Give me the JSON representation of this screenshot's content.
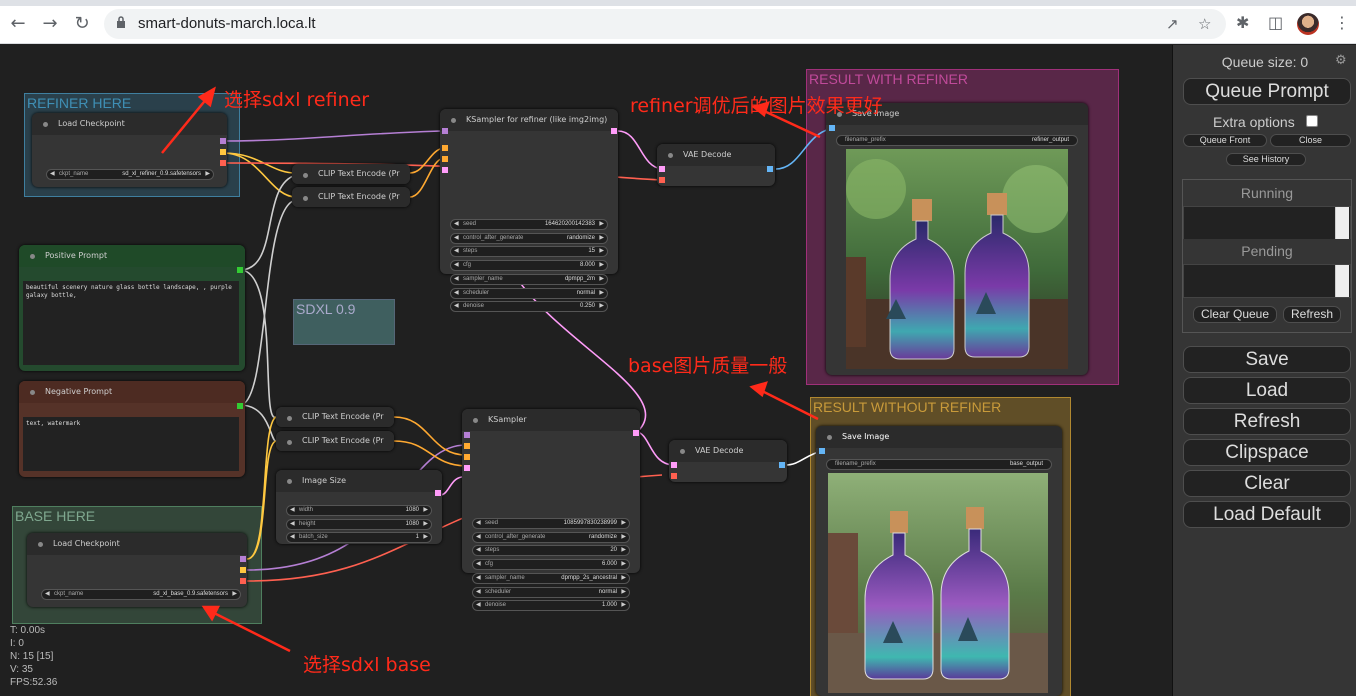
{
  "browser": {
    "url": "smart-donuts-march.loca.lt",
    "back_icon": "arrow-left-icon",
    "forward_icon": "arrow-right-icon",
    "reload_icon": "reload-icon"
  },
  "groups": {
    "refiner": "REFINER HERE",
    "base": "BASE HERE",
    "sdxl": "SDXL 0.9",
    "result_with": "RESULT WITH REFINER",
    "result_without": "RESULT WITHOUT REFINER"
  },
  "nodes": {
    "load_refiner": {
      "title": "Load Checkpoint",
      "ckpt_label": "ckpt_name",
      "ckpt_value": "sd_xl_refiner_0.9.safetensors"
    },
    "load_base": {
      "title": "Load Checkpoint",
      "ckpt_label": "ckpt_name",
      "ckpt_value": "sd_xl_base_0.9.safetensors"
    },
    "positive": {
      "title": "Positive Prompt",
      "text": "beautiful scenery nature glass bottle landscape, , purple galaxy bottle,"
    },
    "negative": {
      "title": "Negative Prompt",
      "text": "text, watermark"
    },
    "clip_r1": {
      "title": "CLIP Text Encode (Pr"
    },
    "clip_r2": {
      "title": "CLIP Text Encode (Pr"
    },
    "clip_b1": {
      "title": "CLIP Text Encode (Pr"
    },
    "clip_b2": {
      "title": "CLIP Text Encode (Pr"
    },
    "ksampler_refiner": {
      "title": "KSampler for refiner (like img2img)",
      "widgets": [
        {
          "label": "seed",
          "value": "164620200142383"
        },
        {
          "label": "control_after_generate",
          "value": "randomize"
        },
        {
          "label": "steps",
          "value": "15"
        },
        {
          "label": "cfg",
          "value": "8.000"
        },
        {
          "label": "sampler_name",
          "value": "dpmpp_2m"
        },
        {
          "label": "scheduler",
          "value": "normal"
        },
        {
          "label": "denoise",
          "value": "0.250"
        }
      ]
    },
    "ksampler_base": {
      "title": "KSampler",
      "widgets": [
        {
          "label": "seed",
          "value": "1085997830238999"
        },
        {
          "label": "control_after_generate",
          "value": "randomize"
        },
        {
          "label": "steps",
          "value": "20"
        },
        {
          "label": "cfg",
          "value": "6.000"
        },
        {
          "label": "sampler_name",
          "value": "dpmpp_2s_ancestral"
        },
        {
          "label": "scheduler",
          "value": "normal"
        },
        {
          "label": "denoise",
          "value": "1.000"
        }
      ]
    },
    "image_size": {
      "title": "Image Size",
      "widgets": [
        {
          "label": "width",
          "value": "1080"
        },
        {
          "label": "height",
          "value": "1080"
        },
        {
          "label": "batch_size",
          "value": "1"
        }
      ]
    },
    "vae_refiner": {
      "title": "VAE Decode"
    },
    "vae_base": {
      "title": "VAE Decode"
    },
    "save_refiner": {
      "title": "Save Image",
      "prefix_label": "filename_prefix",
      "prefix_value": "refiner_output"
    },
    "save_base": {
      "title": "Save Image",
      "prefix_label": "filename_prefix",
      "prefix_value": "base_output"
    }
  },
  "annotations": {
    "select_refiner": "选择sdxl refiner",
    "refiner_better": "refiner调优后的图片效果更好",
    "base_normal": "base图片质量一般",
    "select_base": "选择sdxl base"
  },
  "stats": [
    "T: 0.00s",
    "I: 0",
    "N: 15 [15]",
    "V: 35",
    "FPS:52.36"
  ],
  "panel": {
    "queue_size": "Queue size: 0",
    "queue_prompt": "Queue Prompt",
    "extra_options": "Extra options",
    "queue_front": "Queue Front",
    "close": "Close",
    "see_history": "See History",
    "running": "Running",
    "pending": "Pending",
    "clear_queue": "Clear Queue",
    "refresh_small": "Refresh",
    "save": "Save",
    "load": "Load",
    "refresh": "Refresh",
    "clipspace": "Clipspace",
    "clear": "Clear",
    "load_default": "Load Default"
  },
  "colors": {
    "refiner_group": "#3f7f9f",
    "base_group": "#4f7f5f",
    "sdxl_group": "#3f5f5f",
    "result_with_group": "#a0307a",
    "result_without_group": "#b08830",
    "annotation": "#ff2a1a"
  }
}
